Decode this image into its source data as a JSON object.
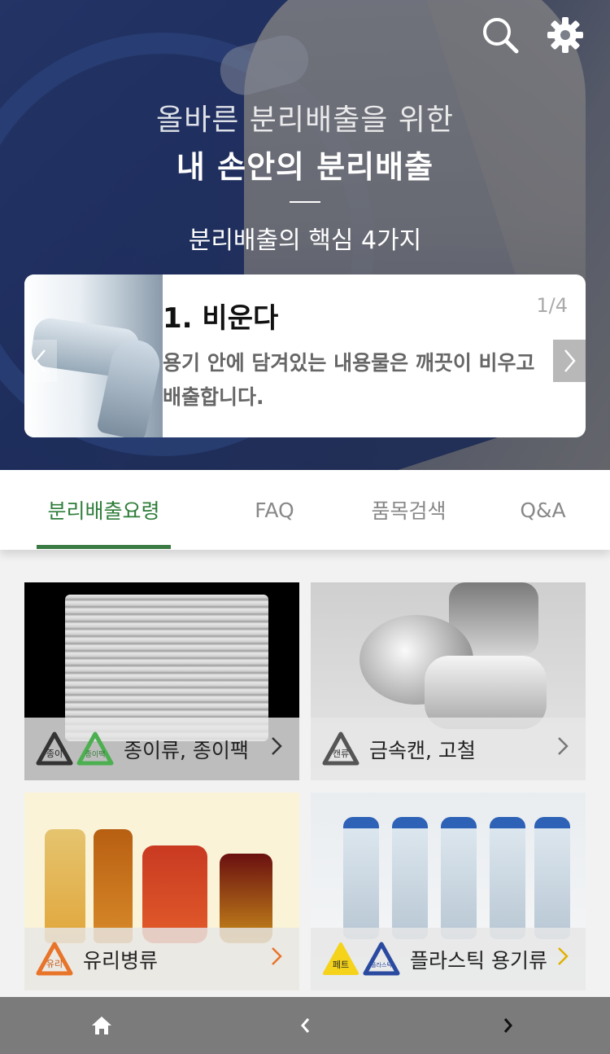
{
  "hero": {
    "subtitle": "올바른 분리배출을 위한",
    "title": "내 손안의 분리배출",
    "key_heading": "분리배출의 핵심 4가지",
    "icons": [
      "search-icon",
      "gear-icon"
    ]
  },
  "card": {
    "title": "1. 비운다",
    "page": "1/4",
    "description": "용기 안에 담겨있는 내용물은 깨끗이 비우고 배출합니다."
  },
  "tabs": [
    {
      "label": "분리배출요령",
      "active": true
    },
    {
      "label": "FAQ",
      "active": false
    },
    {
      "label": "품목검색",
      "active": false
    },
    {
      "label": "Q&A",
      "active": false
    }
  ],
  "categories": [
    {
      "label": "종이류, 종이팩",
      "badges": [
        "종이",
        "종이팩"
      ]
    },
    {
      "label": "금속캔, 고철",
      "badges": [
        "캔류"
      ]
    },
    {
      "label": "유리병류",
      "badges": [
        "유리"
      ]
    },
    {
      "label": "플라스틱 용기류",
      "badges": [
        "페트",
        "플라스틱"
      ]
    }
  ],
  "colors": {
    "accent": "#2e7d3a",
    "bottom_nav": "#7b7b7b"
  },
  "bottom_nav": [
    "home-icon",
    "back-chevron-icon",
    "forward-chevron-icon"
  ]
}
